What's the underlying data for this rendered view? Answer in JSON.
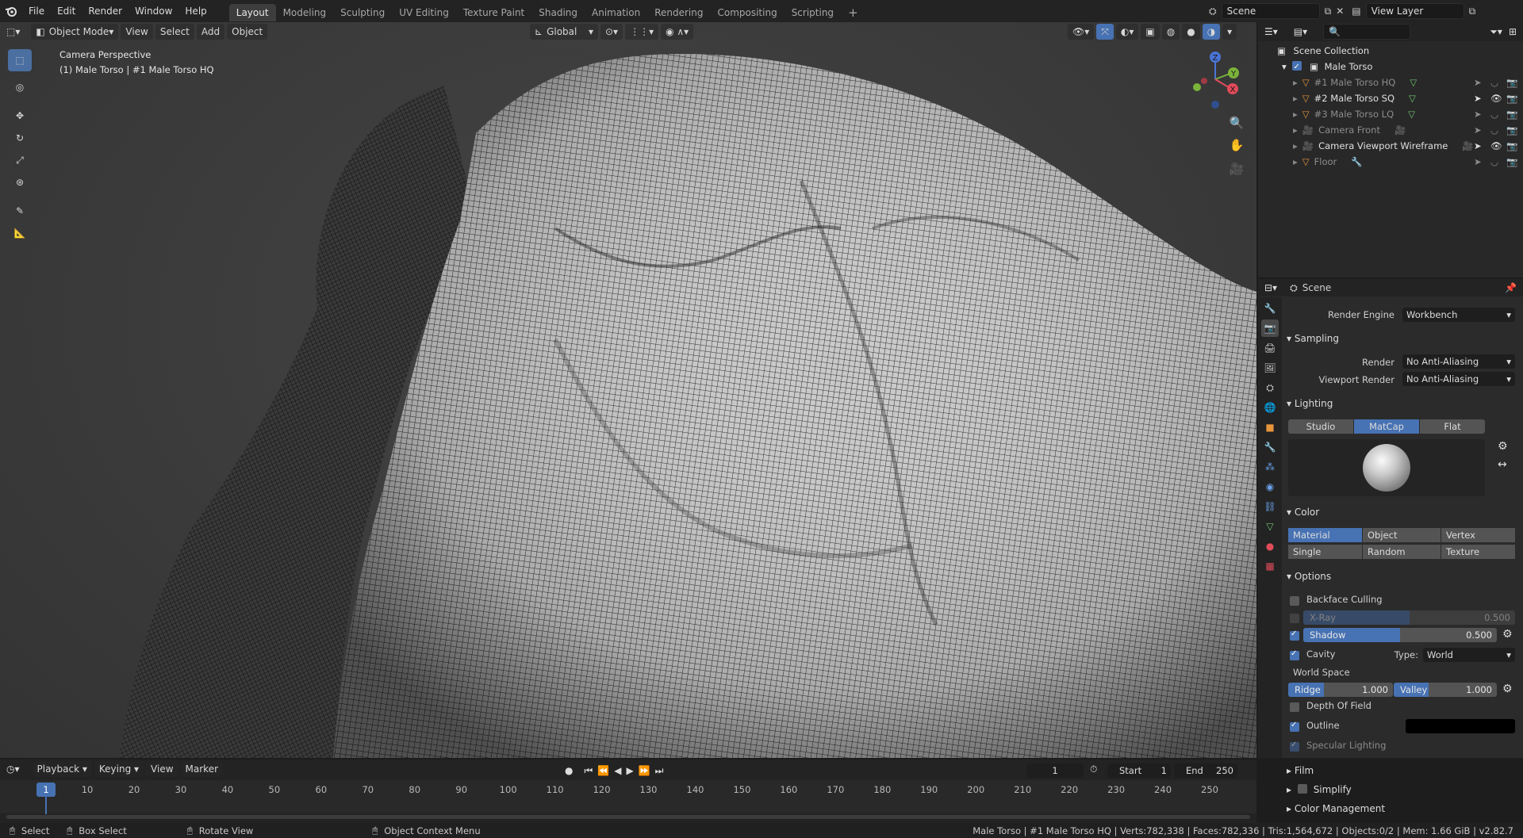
{
  "topbar": {
    "menus": [
      "File",
      "Edit",
      "Render",
      "Window",
      "Help"
    ],
    "workspaces": [
      "Layout",
      "Modeling",
      "Sculpting",
      "UV Editing",
      "Texture Paint",
      "Shading",
      "Animation",
      "Rendering",
      "Compositing",
      "Scripting"
    ],
    "active_workspace": "Layout",
    "add_tab": "+",
    "scene": "Scene",
    "view_layer": "View Layer"
  },
  "viewport": {
    "mode": "Object Mode",
    "menus": [
      "View",
      "Select",
      "Add",
      "Object"
    ],
    "transform_orientation": "Global",
    "overlay_title": "Camera Perspective",
    "overlay_subtitle": "(1) Male Torso | #1 Male Torso HQ",
    "gizmo_axes": {
      "z": "Z",
      "y": "Y",
      "x": "X"
    }
  },
  "outliner": {
    "root": "Scene Collection",
    "collection": "Male Torso",
    "items": [
      {
        "label": "#1 Male Torso HQ",
        "dim": true
      },
      {
        "label": "#2 Male Torso SQ",
        "dim": false
      },
      {
        "label": "#3 Male Torso LQ",
        "dim": true
      },
      {
        "label": "Camera Front",
        "dim": true
      },
      {
        "label": "Camera Viewport Wireframe",
        "dim": false
      },
      {
        "label": "Floor",
        "dim": true
      }
    ]
  },
  "properties": {
    "context": "Scene",
    "render_engine_label": "Render Engine",
    "render_engine": "Workbench",
    "sampling": {
      "title": "Sampling",
      "render_label": "Render",
      "render_value": "No Anti-Aliasing",
      "viewport_label": "Viewport Render",
      "viewport_value": "No Anti-Aliasing"
    },
    "lighting": {
      "title": "Lighting",
      "options": [
        "Studio",
        "MatCap",
        "Flat"
      ],
      "active": "MatCap"
    },
    "color": {
      "title": "Color",
      "options": [
        "Material",
        "Object",
        "Vertex",
        "Single",
        "Random",
        "Texture"
      ],
      "active": "Material"
    },
    "options": {
      "title": "Options",
      "backface_culling": "Backface Culling",
      "xray_label": "X-Ray",
      "xray_value": "0.500",
      "xray_fraction": 0.5,
      "shadow_label": "Shadow",
      "shadow_value": "0.500",
      "shadow_fraction": 0.5,
      "cavity": "Cavity",
      "type_label": "Type:",
      "type_value": "World",
      "world_space": "World Space",
      "ridge_label": "Ridge",
      "ridge_value": "1.000",
      "valley_label": "Valley",
      "valley_value": "1.000",
      "dof": "Depth Of Field",
      "outline": "Outline",
      "outline_color": "#000000",
      "specular": "Specular Lighting"
    },
    "film": "Film",
    "simplify": "Simplify",
    "color_management": "Color Management"
  },
  "timeline": {
    "menus": [
      "Playback",
      "Keying",
      "View",
      "Marker"
    ],
    "current_frame": "1",
    "start_label": "Start",
    "start": "1",
    "end_label": "End",
    "end": "250",
    "ticks": [
      "1",
      "10",
      "20",
      "30",
      "40",
      "50",
      "60",
      "70",
      "80",
      "90",
      "100",
      "110",
      "120",
      "130",
      "140",
      "150",
      "160",
      "170",
      "180",
      "190",
      "200",
      "210",
      "220",
      "230",
      "240",
      "250"
    ]
  },
  "statusbar": {
    "select": "Select",
    "box_select": "Box Select",
    "rotate": "Rotate View",
    "context_menu": "Object Context Menu",
    "stats": "Male Torso | #1 Male Torso HQ | Verts:782,338 | Faces:782,336 | Tris:1,564,672 | Objects:0/2 | Mem: 1.66 GiB | v2.82.7"
  },
  "colors": {
    "accent": "#4772b3",
    "mesh_orange": "#e8953c",
    "mesh_green": "#6fc46f"
  }
}
